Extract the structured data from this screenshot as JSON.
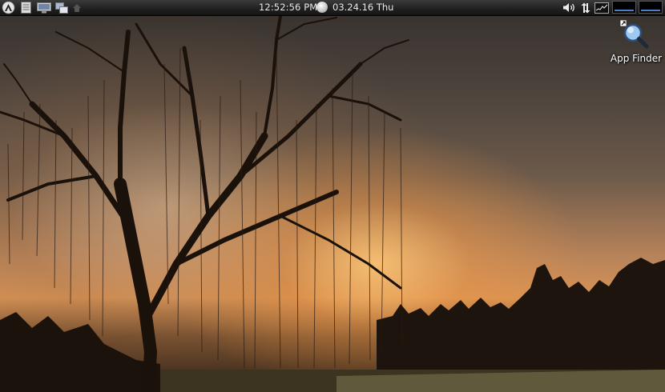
{
  "panel": {
    "launchers": [
      {
        "name": "menu",
        "icon": "app-menu-icon"
      },
      {
        "name": "file-manager",
        "icon": "document-icon"
      },
      {
        "name": "terminal",
        "icon": "monitor-icon"
      },
      {
        "name": "windows",
        "icon": "windows-icon"
      },
      {
        "name": "home",
        "icon": "home-icon"
      }
    ],
    "clock": "12:52:56 PM",
    "date": "03.24.16 Thu",
    "tray": [
      {
        "name": "volume",
        "icon": "speaker-icon"
      },
      {
        "name": "network",
        "icon": "network-arrows-icon"
      },
      {
        "name": "system-monitor",
        "icon": "monitor-graph-icon"
      }
    ]
  },
  "desktop": {
    "icons": [
      {
        "label": "App Finder",
        "icon": "magnifier-icon"
      }
    ]
  },
  "colors": {
    "panel_bg": "#202020",
    "panel_text": "#e8e8e8",
    "tray_bar": "#4a7fd0"
  }
}
